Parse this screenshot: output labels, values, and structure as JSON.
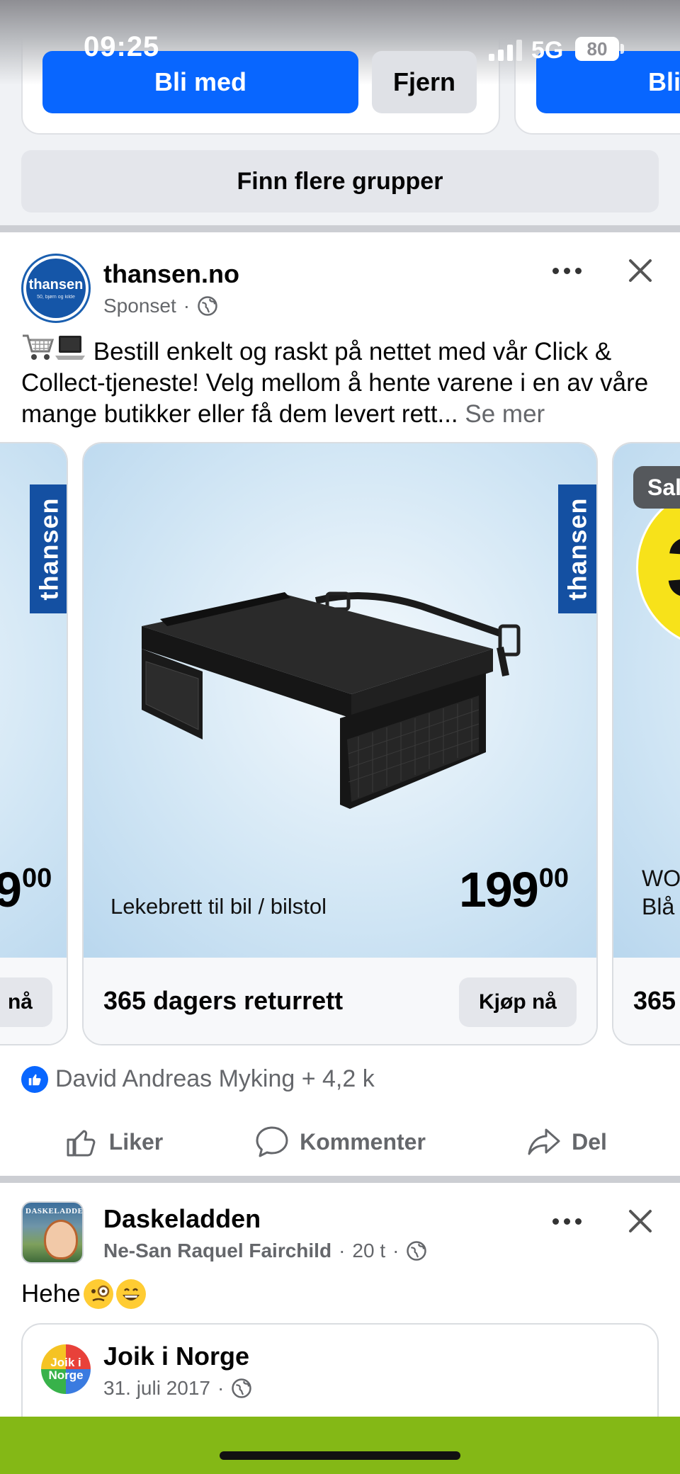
{
  "status_bar": {
    "time": "09:25",
    "network": "5G",
    "battery": "80"
  },
  "groups_strip": {
    "join_label": "Bli med",
    "join_label_partial": "Bli",
    "remove_label": "Fjern",
    "find_more_label": "Finn flere grupper"
  },
  "sponsored_post": {
    "page_name": "thansen.no",
    "avatar_text": "thansen",
    "avatar_subtext": "50, bjørn og kilde",
    "sponsored_label": "Sponset",
    "dot": "·",
    "body_text": "Bestill enkelt og raskt på nettet med vår Click & Collect-tjeneste! Velg mellom å hente varene i en av våre mange butikker eller få dem levert rett...",
    "see_more": "Se mer",
    "carousel": {
      "left_card": {
        "brand": "thansen",
        "price_main": "9",
        "price_cents": "00",
        "button_label": "nå"
      },
      "main_card": {
        "brand": "thansen",
        "product_name": "Lekebrett til bil / bilstol",
        "price_main": "199",
        "price_cents": "00",
        "footer_title": "365 dagers returrett",
        "button_label": "Kjøp nå"
      },
      "right_card": {
        "sale_tag": "Sal",
        "badge_number": "3",
        "product_line1": "WOW",
        "product_line2": "Blå",
        "footer_title": "365"
      }
    },
    "reactions_text": "David Andreas Myking + 4,2 k",
    "actions": {
      "like": "Liker",
      "comment": "Kommenter",
      "share": "Del"
    }
  },
  "second_post": {
    "group_name": "Daskeladden",
    "avatar_label": "DASKELADDEN",
    "author": "Ne-San Raquel Fairchild",
    "time": "20 t",
    "dot": "·",
    "text": "Hehe",
    "shared": {
      "name": "Joik i Norge",
      "avatar_text": "Joik i Norge",
      "date": "31. juli 2017",
      "dot": "·"
    }
  },
  "colors": {
    "accent": "#0866ff",
    "thansen_blue": "#1450a2",
    "bottom_bar": "#84b816"
  }
}
